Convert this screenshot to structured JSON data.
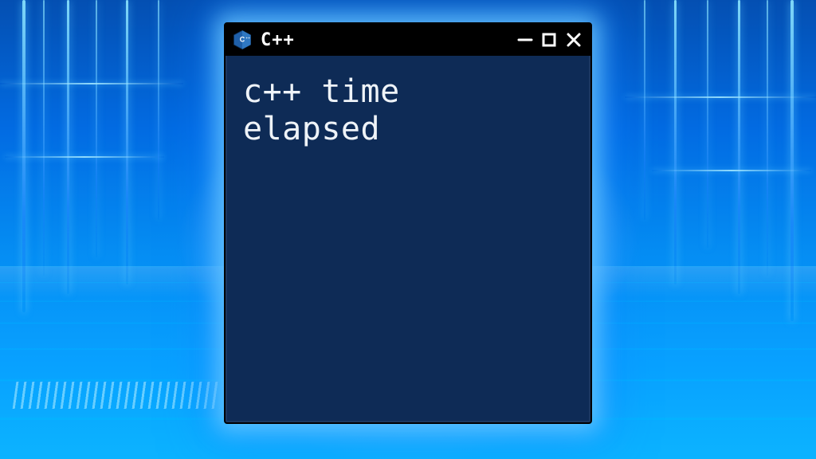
{
  "window": {
    "title": "C++",
    "icon": "cpp-hex-icon",
    "controls": {
      "minimize": "–",
      "maximize": "□",
      "close": "×"
    }
  },
  "content": {
    "body": "c++ time\nelapsed"
  },
  "colors": {
    "window_bg": "#0e2b56",
    "titlebar_bg": "#000000",
    "text": "#eef3f8",
    "glow": "#5cc8ff",
    "background_top": "#0a4ea8",
    "background_bottom": "#18b0ff"
  }
}
